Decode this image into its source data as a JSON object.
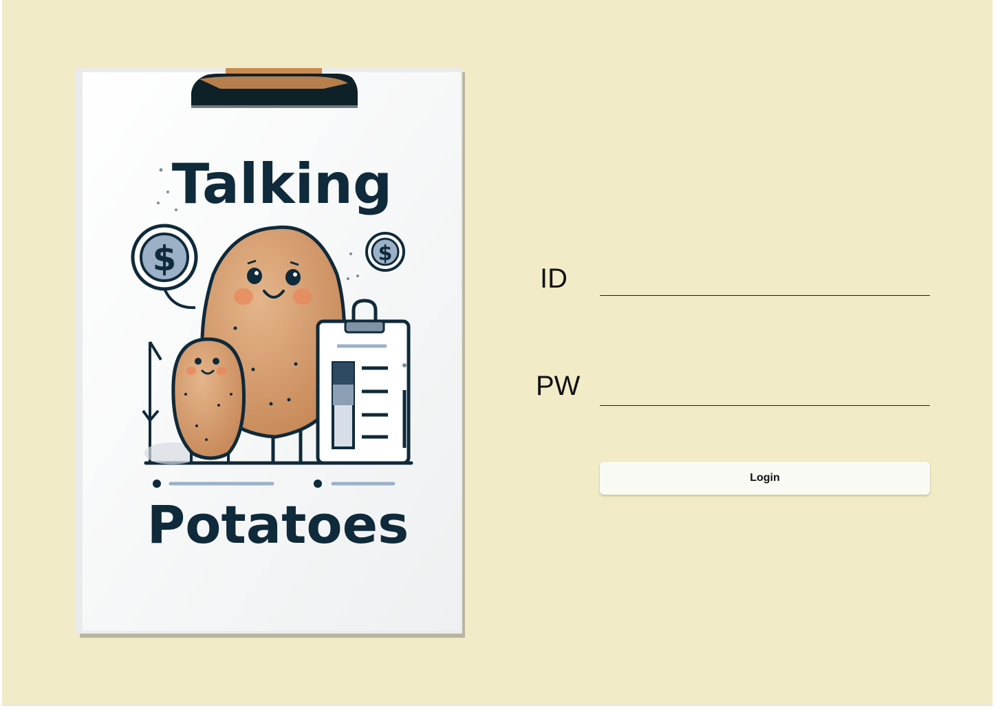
{
  "poster": {
    "title_top": "Talking",
    "title_bottom": "Potatoes",
    "coin_symbol": "$",
    "colors": {
      "paper": "#ffffff",
      "ink": "#0f2a3a",
      "potato": "#d39a6c",
      "cheek": "#e88a5c",
      "clip": "#0f2128",
      "clip_accent": "#c98a4f"
    }
  },
  "form": {
    "id_label": "ID",
    "id_value": "",
    "pw_label": "PW",
    "pw_value": "",
    "login_label": "Login"
  },
  "colors": {
    "background": "#f1ecc7",
    "button_bg": "#fafaf5",
    "text": "#111111"
  }
}
